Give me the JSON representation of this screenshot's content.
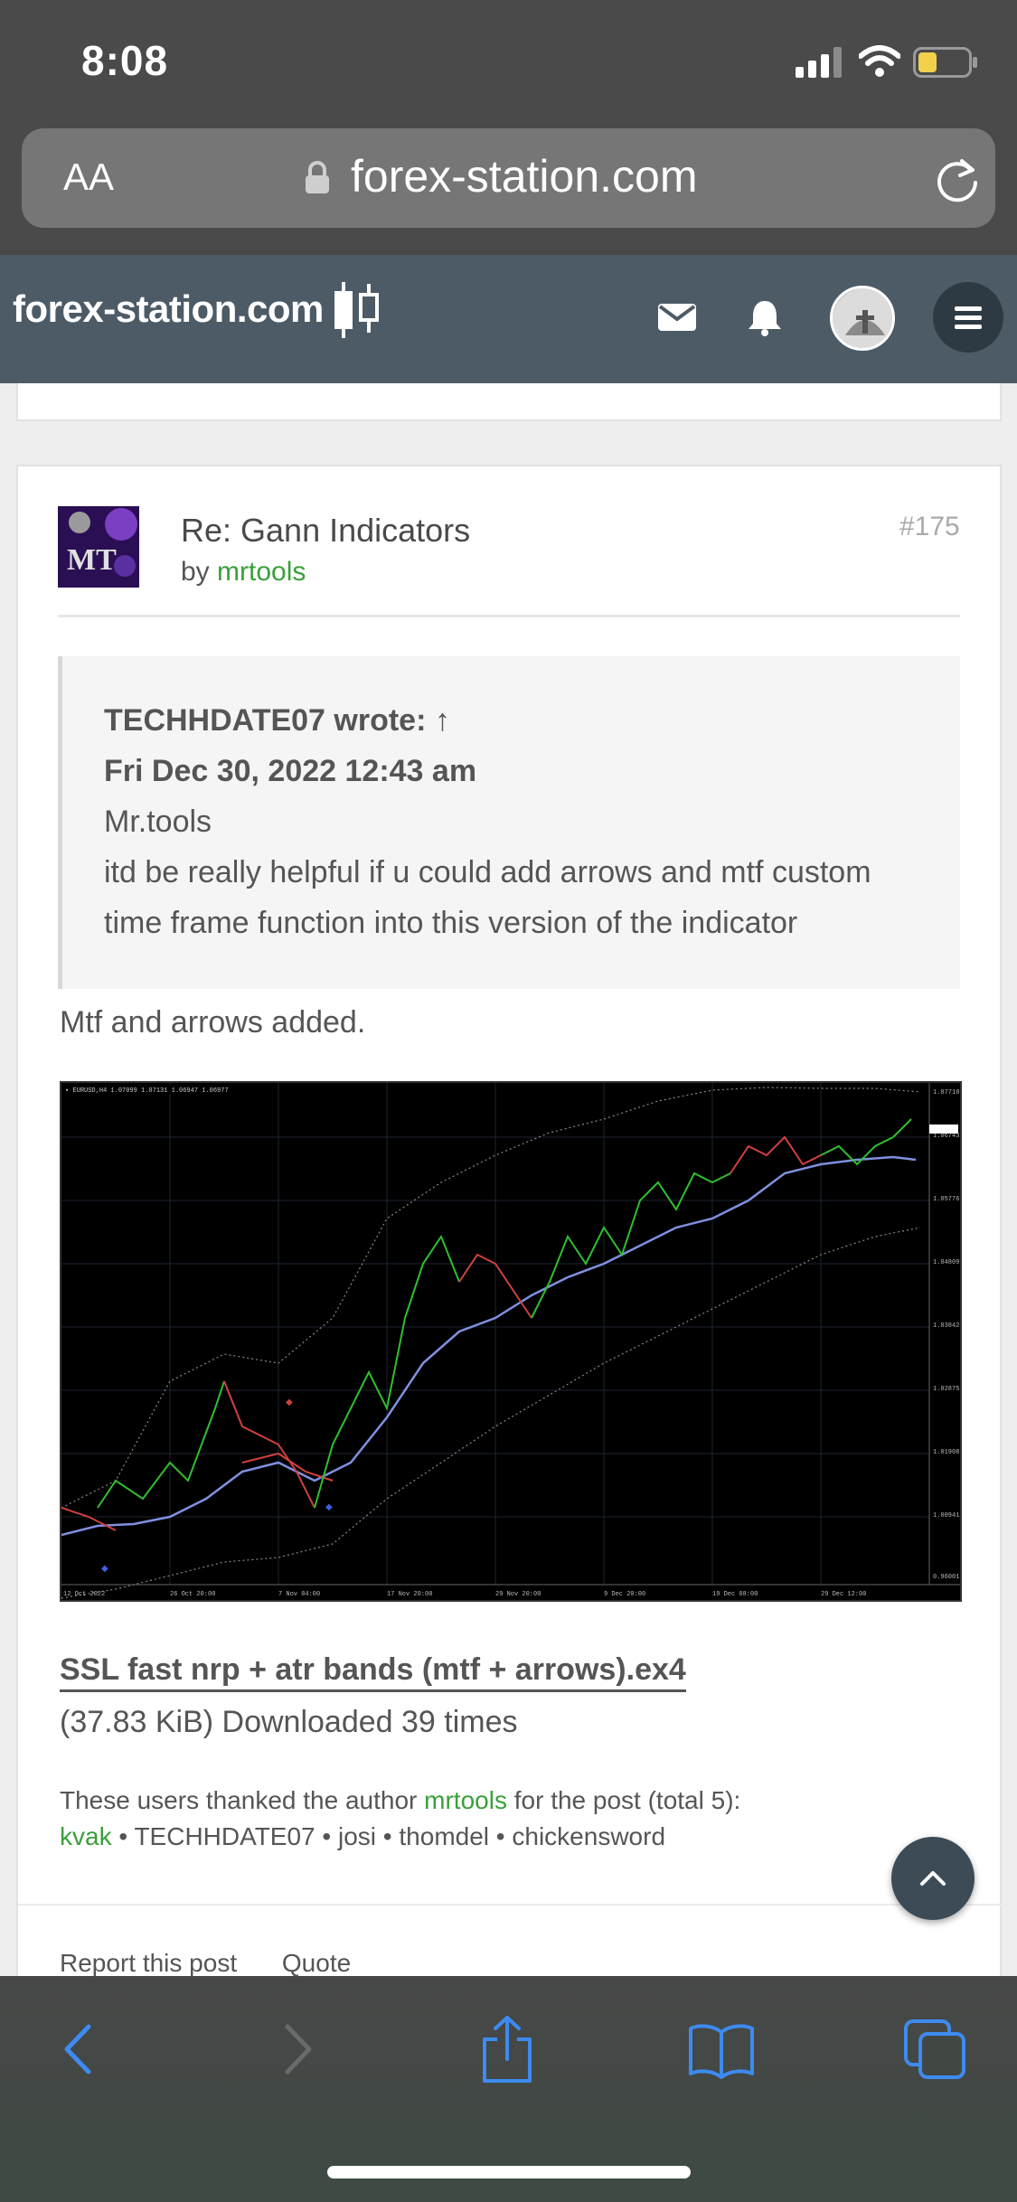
{
  "status_bar": {
    "time": "8:08"
  },
  "browser": {
    "text_size_label": "AA",
    "url": "forex-station.com"
  },
  "site_header": {
    "logo_text": "forex-station.com"
  },
  "post": {
    "title": "Re: Gann Indicators",
    "by_label": "by",
    "author": "mrtools",
    "number": "#175",
    "quote": {
      "author_line": "TECHHDATE07 wrote: ↑",
      "date": "Fri Dec 30, 2022 12:43 am",
      "line1": "Mr.tools",
      "line2": "itd be really helpful if u could add arrows and mtf custom",
      "line3": "time frame function into this version of the indicator"
    },
    "reply": "Mtf and arrows added.",
    "attachment": {
      "filename": "SSL fast nrp + atr bands (mtf + arrows).ex4",
      "meta": "(37.83 KiB) Downloaded 39 times"
    },
    "thanks": {
      "prefix": "These users thanked the author",
      "author": "mrtools",
      "suffix": "for the post (total 5):",
      "users": [
        "kvak",
        "TECHHDATE07",
        "josi",
        "thomdel",
        "chickensword"
      ],
      "separator": " • "
    },
    "footer": {
      "report": "Report this post",
      "quote": "Quote"
    }
  },
  "colors": {
    "accent_green": "#3aa03a",
    "header_bg": "#4d5b66",
    "text": "#555555"
  },
  "icons": [
    "signal-icon",
    "wifi-icon",
    "battery-icon",
    "lock-icon",
    "reload-icon",
    "mail-icon",
    "bell-icon",
    "menu-icon",
    "chevron-up-icon",
    "back-icon",
    "forward-icon",
    "share-icon",
    "bookmarks-icon",
    "tabs-icon"
  ]
}
